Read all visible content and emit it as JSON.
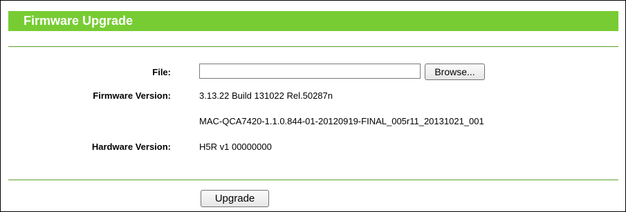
{
  "panel": {
    "title": "Firmware Upgrade"
  },
  "form": {
    "file_label": "File:",
    "file_value": "",
    "browse_label": "Browse...",
    "firmware_label": "Firmware Version:",
    "firmware_version": "3.13.22 Build 131022 Rel.50287n",
    "firmware_build": "MAC-QCA7420-1.1.0.844-01-20120919-FINAL_005r11_20131021_001",
    "hardware_label": "Hardware Version:",
    "hardware_version": "H5R v1 00000000",
    "upgrade_label": "Upgrade"
  },
  "colors": {
    "title_bar": "#77cc33",
    "divider": "#5aa028"
  }
}
